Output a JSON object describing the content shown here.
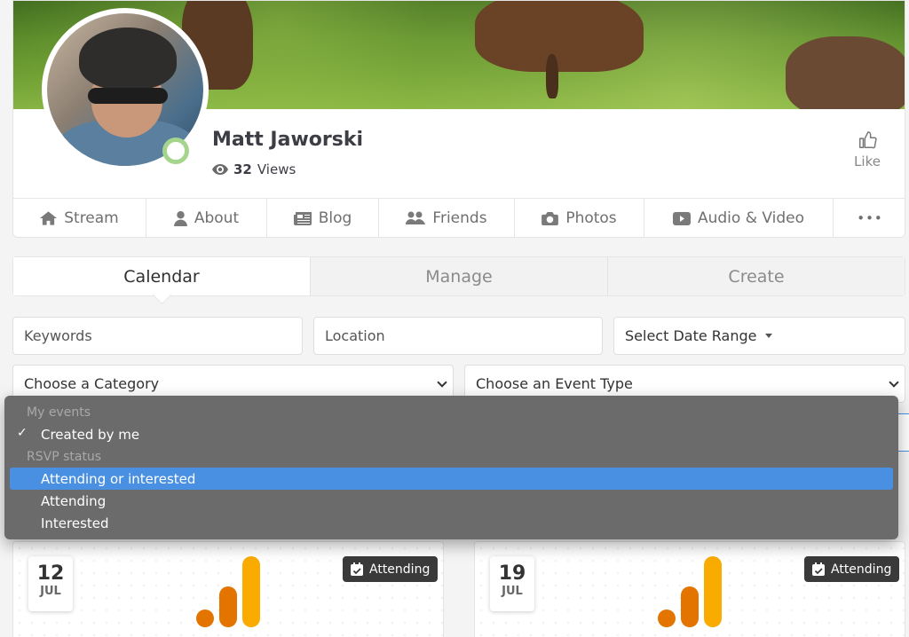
{
  "profile": {
    "name": "Matt Jaworski",
    "views_count": "32",
    "views_label": "Views",
    "like_label": "Like"
  },
  "nav_tabs": [
    {
      "label": "Stream",
      "icon": "home-icon"
    },
    {
      "label": "About",
      "icon": "user-icon"
    },
    {
      "label": "Blog",
      "icon": "newspaper-icon"
    },
    {
      "label": "Friends",
      "icon": "users-icon"
    },
    {
      "label": "Photos",
      "icon": "camera-icon"
    },
    {
      "label": "Audio & Video",
      "icon": "video-icon"
    },
    {
      "label": "•••",
      "icon": "more-icon"
    }
  ],
  "section_tabs": [
    {
      "label": "Calendar",
      "active": true
    },
    {
      "label": "Manage",
      "active": false
    },
    {
      "label": "Create",
      "active": false
    }
  ],
  "filters": {
    "keywords_placeholder": "Keywords",
    "location_placeholder": "Location",
    "date_range_label": "Select Date Range",
    "category_label": "Choose a Category",
    "event_type_label": "Choose an Event Type"
  },
  "dropdown": {
    "group1": "My events",
    "item_created": "Created by me",
    "group2": "RSVP status",
    "item_attending_or_interested": "Attending or interested",
    "item_attending": "Attending",
    "item_interested": "Interested",
    "checked_item": "Created by me",
    "highlighted_item": "Attending or interested"
  },
  "events": [
    {
      "day": "12",
      "month": "JUL",
      "status": "Attending"
    },
    {
      "day": "19",
      "month": "JUL",
      "status": "Attending"
    }
  ],
  "colors": {
    "accent_blue": "#4a90e2",
    "online_green": "#a5d58c",
    "logo_orange": "#f9ab00",
    "logo_dark_orange": "#e37400"
  }
}
